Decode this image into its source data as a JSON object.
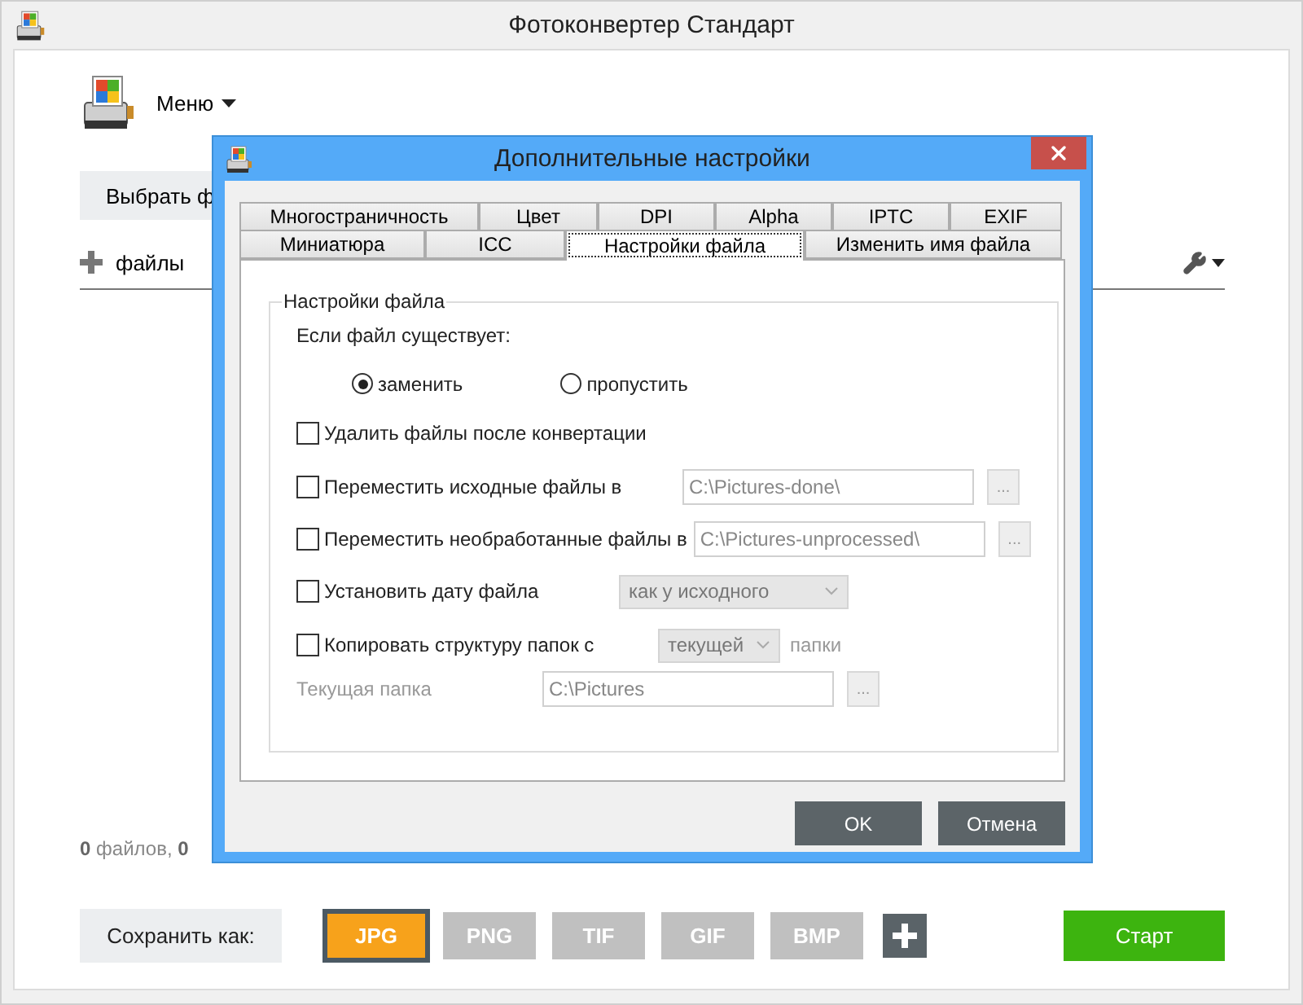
{
  "window": {
    "title": "Фотоконвертер Стандарт"
  },
  "menu": {
    "label": "Меню"
  },
  "select_files_button": "Выбрать ф",
  "files_label": "файлы",
  "status": "**0** файлов, **0**",
  "save_as_label": "Сохранить как:",
  "formats": [
    {
      "label": "JPG",
      "selected": true
    },
    {
      "label": "PNG",
      "selected": false
    },
    {
      "label": "TIF",
      "selected": false
    },
    {
      "label": "GIF",
      "selected": false
    },
    {
      "label": "BMP",
      "selected": false
    }
  ],
  "start_button": "Старт",
  "dialog": {
    "title": "Дополнительные настройки",
    "tab_rows": [
      {
        "tabs": [
          {
            "label": "Многостраничность",
            "selected": false
          },
          {
            "label": "Цвет",
            "selected": false
          },
          {
            "label": "DPI",
            "selected": false
          },
          {
            "label": "Alpha",
            "selected": false
          },
          {
            "label": "IPTC",
            "selected": false
          },
          {
            "label": "EXIF",
            "selected": false
          }
        ]
      },
      {
        "tabs": [
          {
            "label": "Миниатюра",
            "selected": false
          },
          {
            "label": "ICC",
            "selected": false
          },
          {
            "label": "Настройки файла",
            "selected": true
          },
          {
            "label": "Изменить имя файла",
            "selected": false
          }
        ]
      }
    ],
    "group_title": "Настройки файла",
    "if_exists_label": "Если файл существует:",
    "radios": [
      {
        "label": "заменить",
        "selected": true
      },
      {
        "label": "пропустить",
        "selected": false
      }
    ],
    "options": [
      {
        "kind": "checkbox",
        "label": "Удалить файлы после конвертации",
        "checked": false
      },
      {
        "kind": "path",
        "label": "Переместить исходные файлы в",
        "checked": false,
        "value": "C:\\Pictures-done\\",
        "disabled": true,
        "browse": "..."
      },
      {
        "kind": "path",
        "label": "Переместить необработанные файлы в",
        "checked": false,
        "value": "C:\\Pictures-unprocessed\\",
        "disabled": true,
        "browse": "..."
      },
      {
        "kind": "select",
        "label": "Установить дату файла",
        "checked": false,
        "value": "как у исходного",
        "disabled": true
      },
      {
        "kind": "select",
        "label": "Копировать структуру папок с",
        "checked": false,
        "value": "текущей",
        "suffix": "папки",
        "disabled": true
      },
      {
        "kind": "folder",
        "label": "Текущая папка",
        "value": "C:\\Pictures",
        "disabled": true,
        "browse": "..."
      }
    ],
    "buttons": [
      {
        "label": "OK"
      },
      {
        "label": "Отмена"
      }
    ]
  }
}
